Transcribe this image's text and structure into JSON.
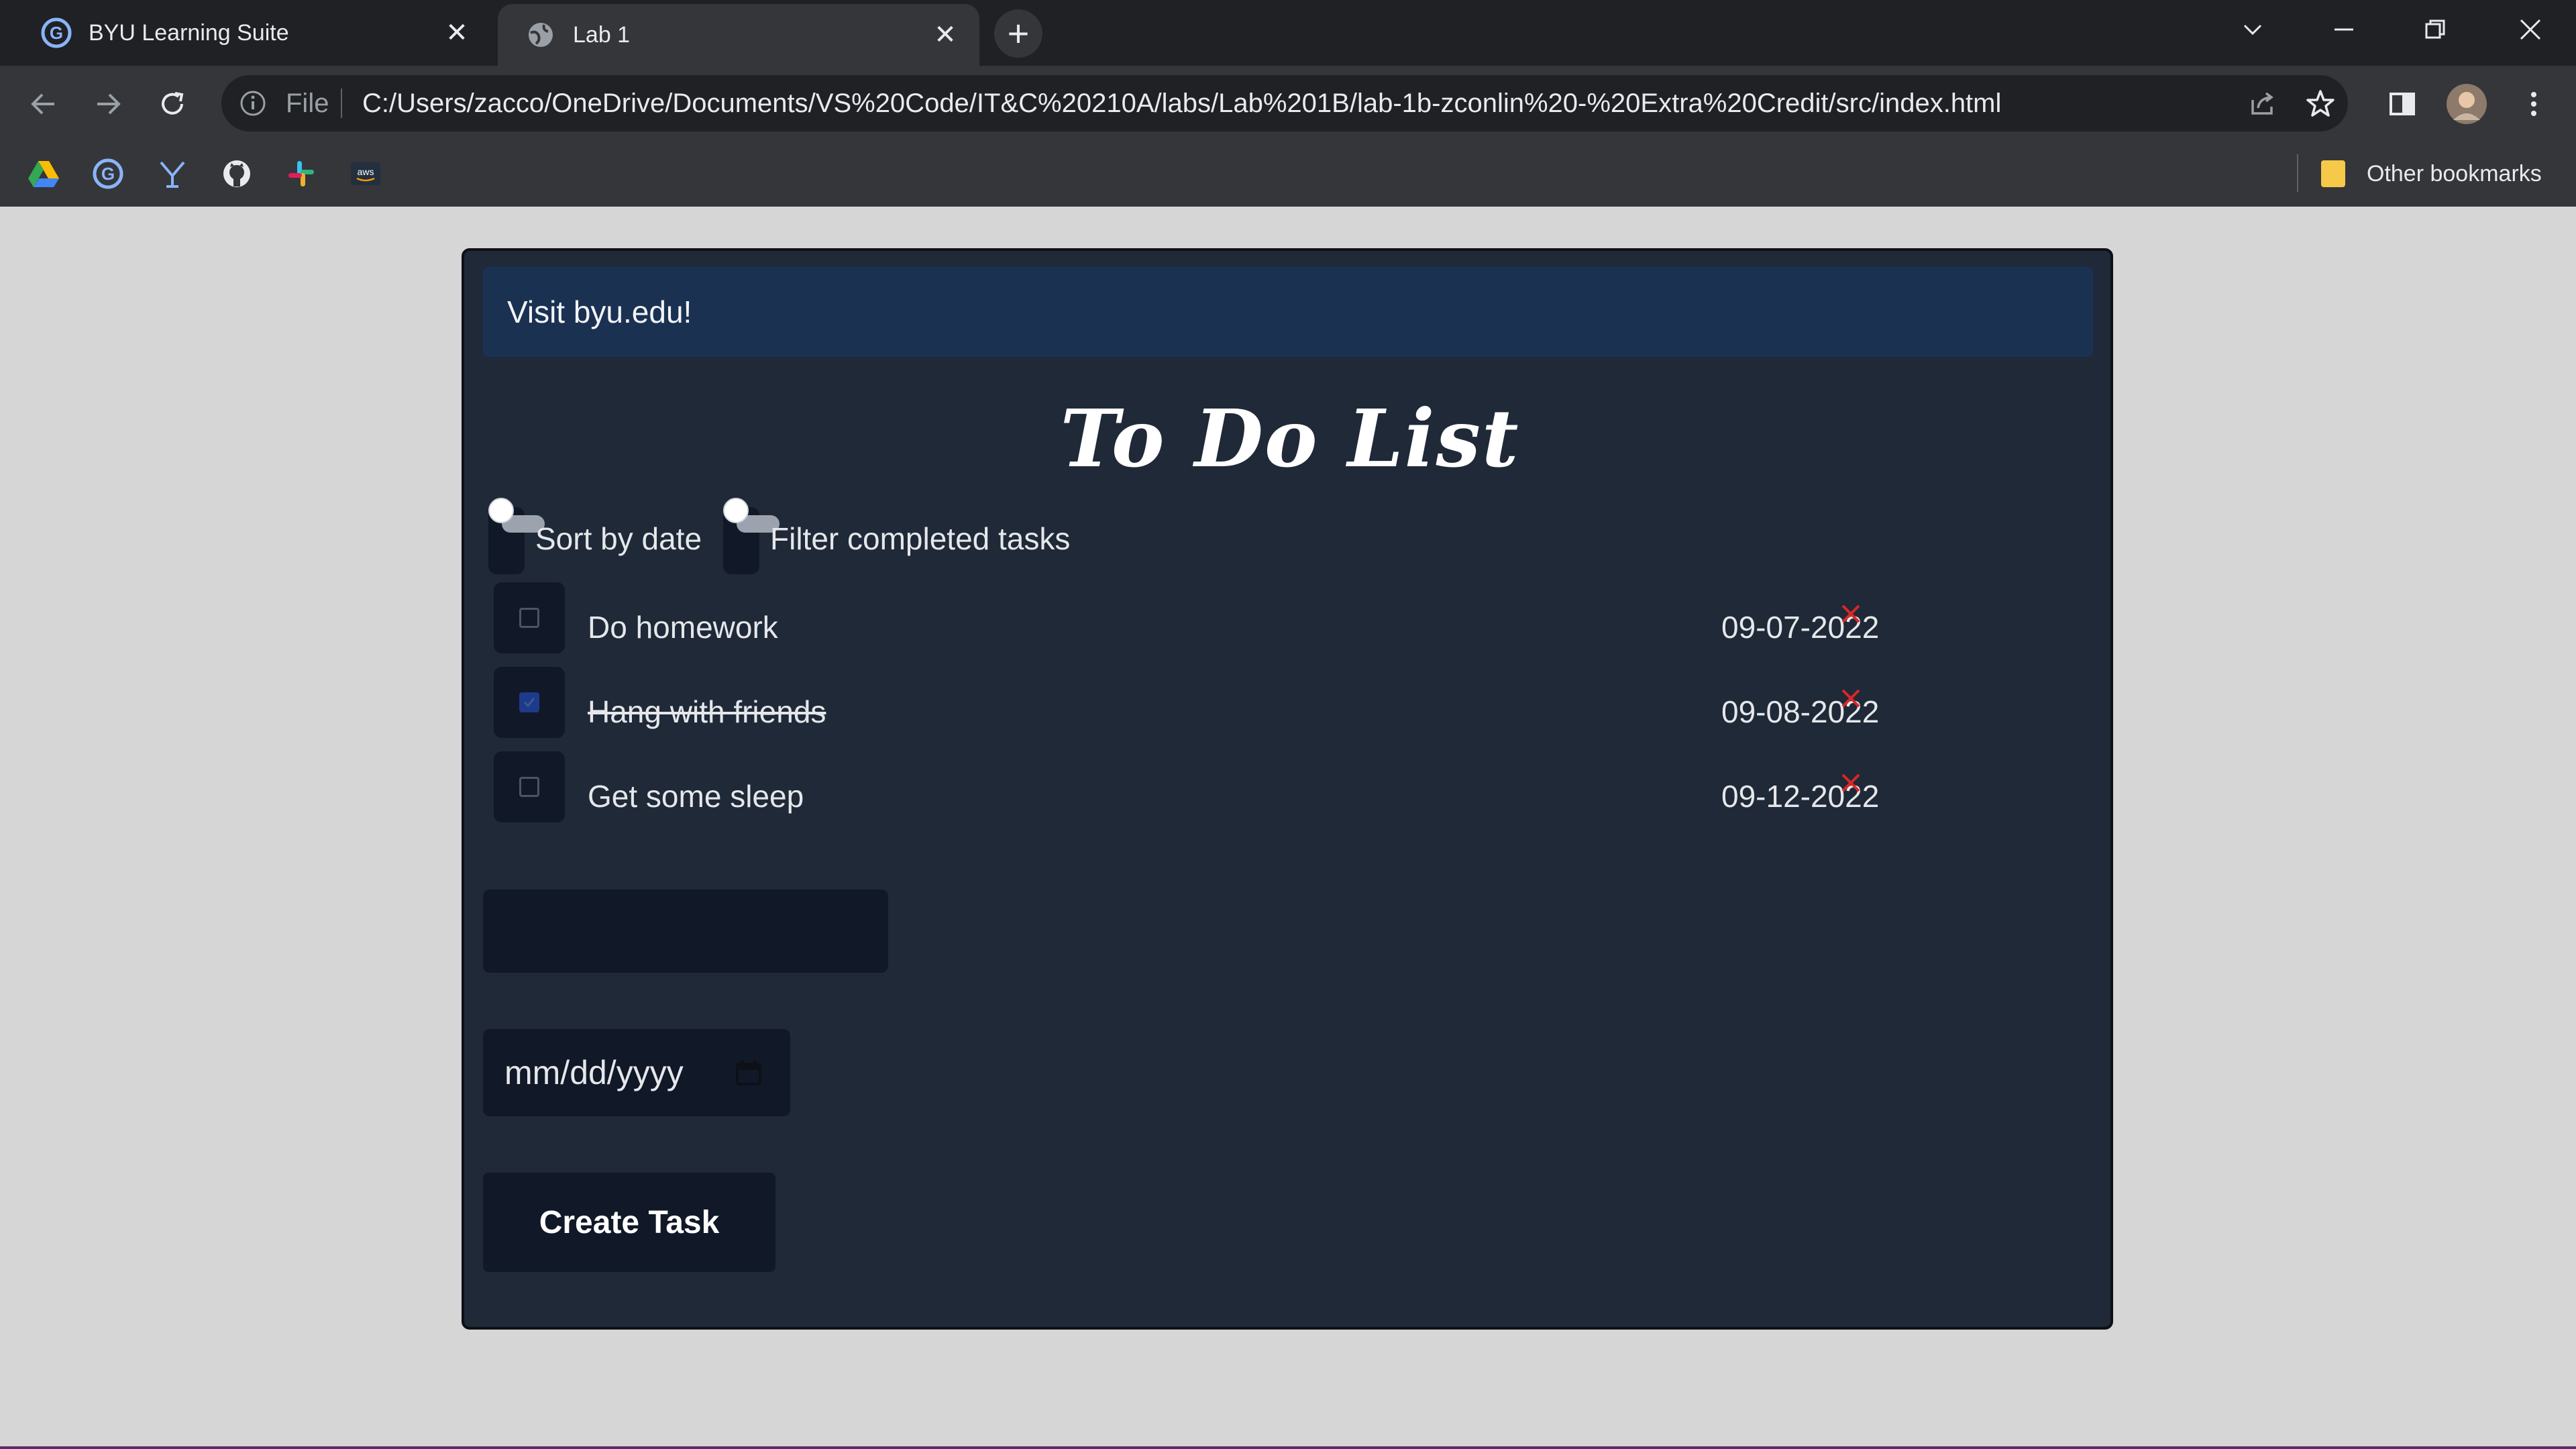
{
  "browser": {
    "tabs": [
      {
        "title": "BYU Learning Suite",
        "active": false
      },
      {
        "title": "Lab 1",
        "active": true
      }
    ],
    "new_tab_label": "+",
    "address": {
      "scheme_label": "File",
      "url": "C:/Users/zacco/OneDrive/Documents/VS%20Code/IT&C%20210A/labs/Lab%201B/lab-1b-zconlin%20-%20Extra%20Credit/src/index.html"
    },
    "bookmarks": {
      "icons": [
        "google-drive-icon",
        "learning-suite-icon",
        "y-icon",
        "github-icon",
        "slack-icon",
        "aws-icon"
      ],
      "aws_label": "aws",
      "other_label": "Other bookmarks"
    }
  },
  "page": {
    "banner_text": "Visit byu.edu!",
    "title": "To Do List",
    "toggles": [
      {
        "label": "Sort by date",
        "on": false
      },
      {
        "label": "Filter completed tasks",
        "on": false
      }
    ],
    "tasks": [
      {
        "name": "Do homework",
        "date": "09-07-2022",
        "completed": false
      },
      {
        "name": "Hang with friends",
        "date": "09-08-2022",
        "completed": true
      },
      {
        "name": "Get some sleep",
        "date": "09-12-2022",
        "completed": false
      }
    ],
    "new_task_value": "",
    "date_placeholder": "mm/dd/yyyy",
    "create_button_label": "Create Task"
  },
  "colors": {
    "background": "#d6d6d6",
    "card": "#1f2937",
    "banner": "#1a3152",
    "delete": "#dc2626",
    "checked": "#1e3a8a"
  }
}
